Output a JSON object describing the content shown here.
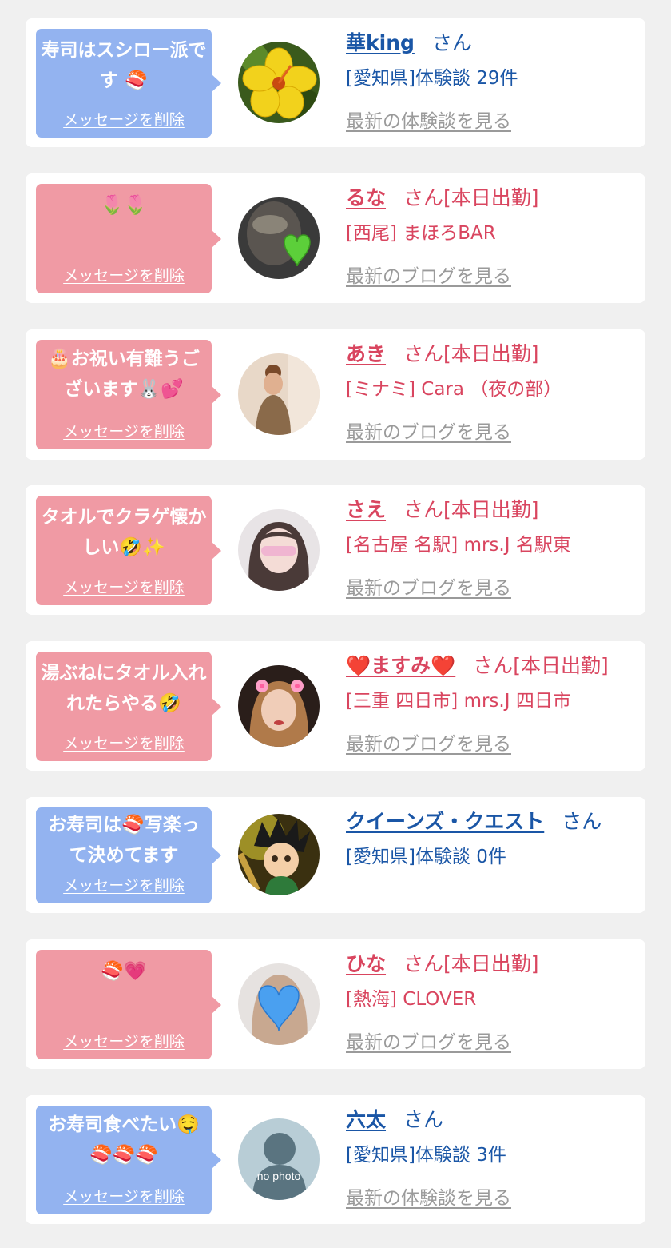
{
  "delete_label": "メッセージを削除",
  "colors": {
    "user_blue": "#1a56a6",
    "cast_pink": "#d9455f",
    "bubble_blue": "#93b3f0",
    "bubble_pink": "#f09aa4",
    "link_gray": "#9a9a9a"
  },
  "items": [
    {
      "kind": "user",
      "message": "寿司はスシロー派です 🍣",
      "name": "華king",
      "suffix": "さん",
      "subtitle": "[愛知県]体験談 29件",
      "latest_link": "最新の体験談を見る",
      "avatar_icon": "yellow-hibiscus-photo"
    },
    {
      "kind": "cast",
      "message": "🌷🌷",
      "name": "るな",
      "suffix": "さん[本日出勤]",
      "subtitle": "[西尾] まほろBAR",
      "latest_link": "最新のブログを見る",
      "avatar_icon": "green-heart-photo"
    },
    {
      "kind": "cast",
      "message": "🎂お祝い有難うございます🐰💕",
      "name": "あき",
      "suffix": "さん[本日出勤]",
      "subtitle": "[ミナミ] Cara （夜の部）",
      "latest_link": "最新のブログを見る",
      "avatar_icon": "woman-back-photo"
    },
    {
      "kind": "cast",
      "message": "タオルでクラゲ懐かしい🤣✨",
      "name": "さえ",
      "suffix": "さん[本日出勤]",
      "subtitle": "[名古屋 名駅] mrs.J 名駅東",
      "latest_link": "最新のブログを見る",
      "avatar_icon": "woman-portrait-photo"
    },
    {
      "kind": "cast",
      "message": "湯ぶねにタオル入れれたらやる🤣",
      "name": "❤️ますみ❤️",
      "suffix": "さん[本日出勤]",
      "subtitle": "[三重 四日市] mrs.J 四日市",
      "latest_link": "最新のブログを見る",
      "avatar_icon": "woman-selfie-photo"
    },
    {
      "kind": "user",
      "message": "お寿司は🍣写楽って決めてます",
      "name": "クイーンズ・クエスト",
      "suffix": "さん",
      "subtitle": "[愛知県]体験談 0件",
      "latest_link": "",
      "avatar_icon": "anime-boy-illustration"
    },
    {
      "kind": "cast",
      "message": "🍣💗",
      "name": "ひな",
      "suffix": "さん[本日出勤]",
      "subtitle": "[熱海] CLOVER",
      "latest_link": "最新のブログを見る",
      "avatar_icon": "blue-heart-photo"
    },
    {
      "kind": "user",
      "message": "お寿司食べたい🤤🍣🍣🍣",
      "name": "六太",
      "suffix": "さん",
      "subtitle": "[愛知県]体験談 3件",
      "latest_link": "最新の体験談を見る",
      "avatar_icon": "no-photo-placeholder",
      "avatar_text": "no photo"
    }
  ]
}
